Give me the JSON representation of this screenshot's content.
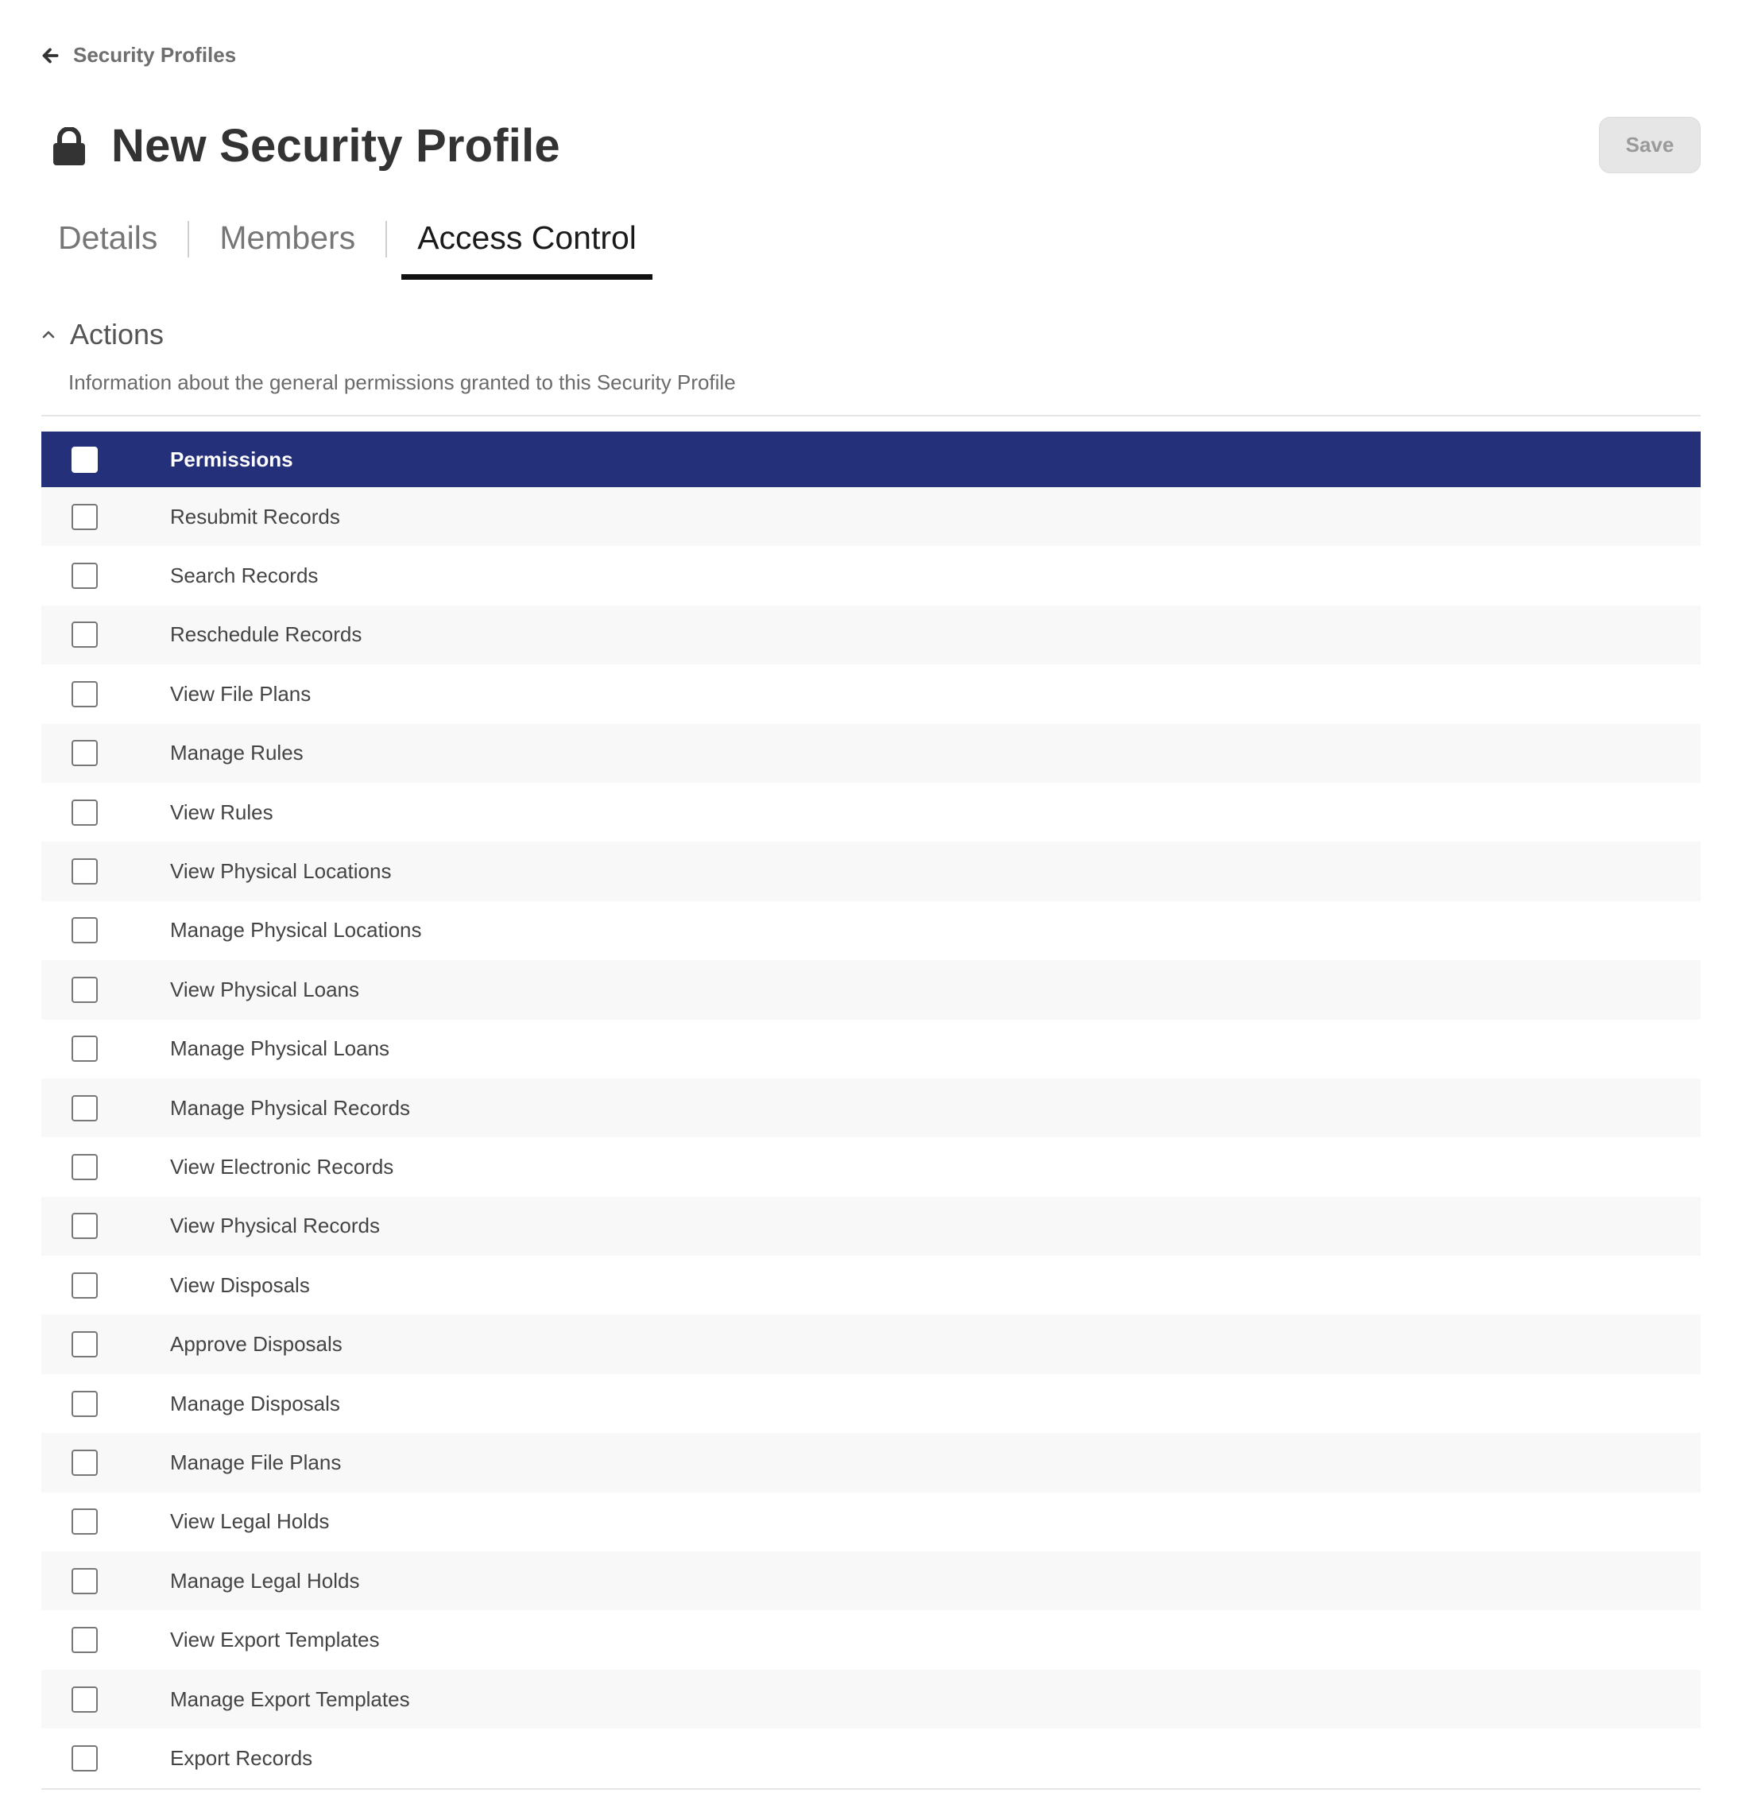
{
  "breadcrumb": {
    "back_label": "Security Profiles"
  },
  "header": {
    "title": "New Security Profile",
    "save_label": "Save"
  },
  "tabs": [
    {
      "label": "Details",
      "active": false
    },
    {
      "label": "Members",
      "active": false
    },
    {
      "label": "Access Control",
      "active": true
    }
  ],
  "section": {
    "title": "Actions",
    "expanded": true,
    "description": "Information about the general permissions granted to this Security Profile"
  },
  "table": {
    "header_label": "Permissions",
    "header_color": "#25307a",
    "rows": [
      {
        "label": "Resubmit Records",
        "checked": false
      },
      {
        "label": "Search Records",
        "checked": false
      },
      {
        "label": "Reschedule Records",
        "checked": false
      },
      {
        "label": "View File Plans",
        "checked": false
      },
      {
        "label": "Manage Rules",
        "checked": false
      },
      {
        "label": "View Rules",
        "checked": false
      },
      {
        "label": "View Physical Locations",
        "checked": false
      },
      {
        "label": "Manage Physical Locations",
        "checked": false
      },
      {
        "label": "View Physical Loans",
        "checked": false
      },
      {
        "label": "Manage Physical Loans",
        "checked": false
      },
      {
        "label": "Manage Physical Records",
        "checked": false
      },
      {
        "label": "View Electronic Records",
        "checked": false
      },
      {
        "label": "View Physical Records",
        "checked": false
      },
      {
        "label": "View Disposals",
        "checked": false
      },
      {
        "label": "Approve Disposals",
        "checked": false
      },
      {
        "label": "Manage Disposals",
        "checked": false
      },
      {
        "label": "Manage File Plans",
        "checked": false
      },
      {
        "label": "View Legal Holds",
        "checked": false
      },
      {
        "label": "Manage Legal Holds",
        "checked": false
      },
      {
        "label": "View Export Templates",
        "checked": false
      },
      {
        "label": "Manage Export Templates",
        "checked": false
      },
      {
        "label": "Export Records",
        "checked": false
      }
    ]
  },
  "icons": {
    "back": "arrow-left-icon",
    "lock": "lock-icon",
    "section_toggle": "chevron-up-icon"
  }
}
